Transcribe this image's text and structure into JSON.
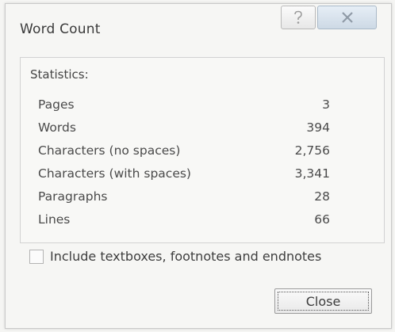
{
  "window": {
    "title": "Word Count",
    "help_icon": "question-mark-icon",
    "close_icon": "close-x-icon"
  },
  "statistics": {
    "heading": "Statistics:",
    "rows": [
      {
        "label": "Pages",
        "value": "3"
      },
      {
        "label": "Words",
        "value": "394"
      },
      {
        "label": "Characters (no spaces)",
        "value": "2,756"
      },
      {
        "label": "Characters (with spaces)",
        "value": "3,341"
      },
      {
        "label": "Paragraphs",
        "value": "28"
      },
      {
        "label": "Lines",
        "value": "66"
      }
    ]
  },
  "options": {
    "include_label": "Include textboxes, footnotes and endnotes",
    "include_checked": false
  },
  "buttons": {
    "close_label": "Close"
  }
}
